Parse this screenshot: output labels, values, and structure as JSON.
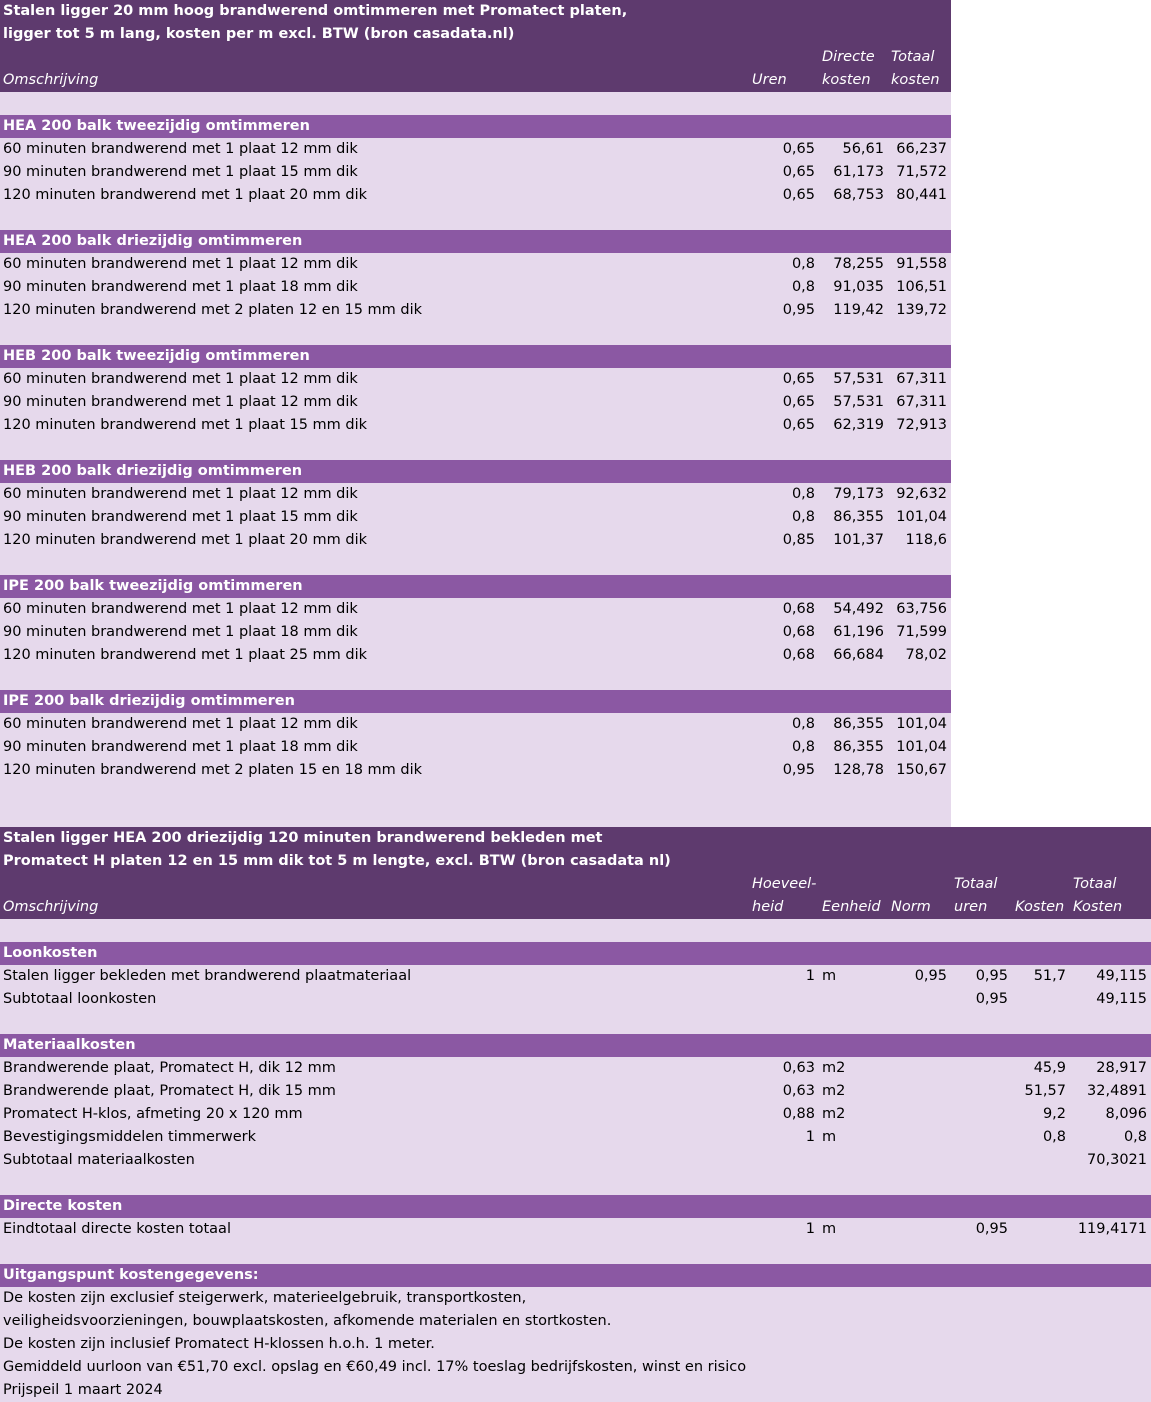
{
  "table1": {
    "title_line1": "Stalen ligger 20 mm hoog brandwerend omtimmeren met Promatect platen,",
    "title_line2": "ligger tot 5 m lang, kosten per m excl. BTW (bron casadata.nl)",
    "headers": {
      "omschrijving": "Omschrijving",
      "uren": "Uren",
      "directe_1": "Directe",
      "directe_2": "kosten",
      "totaal_1": "Totaal",
      "totaal_2": "kosten"
    },
    "sections": [
      {
        "title": "HEA 200 balk tweezijdig omtimmeren",
        "rows": [
          {
            "desc": "60 minuten brandwerend met 1 plaat 12 mm dik",
            "uren": "0,65",
            "direct": "56,61",
            "totaal": "66,237"
          },
          {
            "desc": "90 minuten brandwerend met 1 plaat 15 mm dik",
            "uren": "0,65",
            "direct": "61,173",
            "totaal": "71,572"
          },
          {
            "desc": "120 minuten brandwerend met 1 plaat 20 mm dik",
            "uren": "0,65",
            "direct": "68,753",
            "totaal": "80,441"
          }
        ]
      },
      {
        "title": "HEA 200 balk driezijdig omtimmeren",
        "rows": [
          {
            "desc": "60 minuten brandwerend met 1 plaat 12 mm dik",
            "uren": "0,8",
            "direct": "78,255",
            "totaal": "91,558"
          },
          {
            "desc": "90 minuten brandwerend met 1 plaat 18 mm dik",
            "uren": "0,8",
            "direct": "91,035",
            "totaal": "106,51"
          },
          {
            "desc": "120 minuten brandwerend met 2 platen 12 en 15 mm dik",
            "uren": "0,95",
            "direct": "119,42",
            "totaal": "139,72"
          }
        ]
      },
      {
        "title": "HEB 200 balk tweezijdig omtimmeren",
        "rows": [
          {
            "desc": "60 minuten brandwerend met 1 plaat 12 mm dik",
            "uren": "0,65",
            "direct": "57,531",
            "totaal": "67,311"
          },
          {
            "desc": "90 minuten brandwerend met 1 plaat 12 mm dik",
            "uren": "0,65",
            "direct": "57,531",
            "totaal": "67,311"
          },
          {
            "desc": "120 minuten brandwerend met 1 plaat 15 mm dik",
            "uren": "0,65",
            "direct": "62,319",
            "totaal": "72,913"
          }
        ]
      },
      {
        "title": "HEB 200 balk driezijdig omtimmeren",
        "rows": [
          {
            "desc": "60 minuten brandwerend met 1 plaat 12 mm dik",
            "uren": "0,8",
            "direct": "79,173",
            "totaal": "92,632"
          },
          {
            "desc": "90 minuten brandwerend met 1 plaat 15 mm dik",
            "uren": "0,8",
            "direct": "86,355",
            "totaal": "101,04"
          },
          {
            "desc": "120 minuten brandwerend met 1 plaat 20 mm dik",
            "uren": "0,85",
            "direct": "101,37",
            "totaal": "118,6"
          }
        ]
      },
      {
        "title": "IPE 200 balk tweezijdig omtimmeren",
        "rows": [
          {
            "desc": "60 minuten brandwerend met 1 plaat 12 mm dik",
            "uren": "0,68",
            "direct": "54,492",
            "totaal": "63,756"
          },
          {
            "desc": "90 minuten brandwerend met 1 plaat 18 mm dik",
            "uren": "0,68",
            "direct": "61,196",
            "totaal": "71,599"
          },
          {
            "desc": "120 minuten brandwerend met 1 plaat 25 mm dik",
            "uren": "0,68",
            "direct": "66,684",
            "totaal": "78,02"
          }
        ]
      },
      {
        "title": "IPE 200 balk driezijdig omtimmeren",
        "rows": [
          {
            "desc": "60 minuten brandwerend met 1 plaat 12 mm dik",
            "uren": "0,8",
            "direct": "86,355",
            "totaal": "101,04"
          },
          {
            "desc": "90 minuten brandwerend met 1 plaat 18 mm dik",
            "uren": "0,8",
            "direct": "86,355",
            "totaal": "101,04"
          },
          {
            "desc": "120 minuten brandwerend met 2 platen 15 en 18 mm dik",
            "uren": "0,95",
            "direct": "128,78",
            "totaal": "150,67"
          }
        ]
      }
    ]
  },
  "table2": {
    "title_line1": "Stalen ligger HEA 200 driezijdig 120 minuten brandwerend bekleden met",
    "title_line2": "Promatect H platen  12 en 15 mm dik tot 5 m lengte, excl. BTW (bron casadata nl)",
    "headers": {
      "omschrijving": "Omschrijving",
      "hoeveel_1": "Hoeveel-",
      "hoeveel_2": "heid",
      "eenheid": "Eenheid",
      "norm": "Norm",
      "totaal_uren_1": "Totaal",
      "totaal_uren_2": "uren",
      "kosten": "Kosten",
      "totaal_kosten_1": "Totaal",
      "totaal_kosten_2": "Kosten"
    },
    "loon": {
      "title": "Loonkosten",
      "rows": [
        {
          "desc": "Stalen ligger bekleden met brandwerend plaatmateriaal",
          "qty": "1",
          "unit": "m",
          "norm": "0,95",
          "uren": "0,95",
          "kosten": "51,7",
          "totaal": "49,115"
        },
        {
          "desc": "Subtotaal loonkosten",
          "qty": "",
          "unit": "",
          "norm": "",
          "uren": "0,95",
          "kosten": "",
          "totaal": "49,115"
        }
      ]
    },
    "materiaal": {
      "title": "Materiaalkosten",
      "rows": [
        {
          "desc": "Brandwerende plaat, Promatect H, dik 12 mm",
          "qty": "0,63",
          "unit": "m2",
          "norm": "",
          "uren": "",
          "kosten": "45,9",
          "totaal": "28,917"
        },
        {
          "desc": "Brandwerende plaat, Promatect H, dik 15 mm",
          "qty": "0,63",
          "unit": "m2",
          "norm": "",
          "uren": "",
          "kosten": "51,57",
          "totaal": "32,4891"
        },
        {
          "desc": "Promatect H-klos, afmeting 20 x 120 mm",
          "qty": "0,88",
          "unit": "m2",
          "norm": "",
          "uren": "",
          "kosten": "9,2",
          "totaal": "8,096"
        },
        {
          "desc": "Bevestigingsmiddelen timmerwerk",
          "qty": "1",
          "unit": "m",
          "norm": "",
          "uren": "",
          "kosten": "0,8",
          "totaal": "0,8"
        },
        {
          "desc": "Subtotaal materiaalkosten",
          "qty": "",
          "unit": "",
          "norm": "",
          "uren": "",
          "kosten": "",
          "totaal": "70,3021"
        }
      ]
    },
    "directe": {
      "title": "Directe kosten",
      "rows": [
        {
          "desc": "Eindtotaal directe kosten totaal",
          "qty": "1",
          "unit": "m",
          "norm": "",
          "uren": "0,95",
          "kosten": "",
          "totaal": "119,4171"
        }
      ]
    },
    "uitgangspunt": {
      "title": "Uitgangspunt kostengegevens:",
      "lines": [
        "De kosten zijn exclusief  steigerwerk, materieelgebruik, transportkosten,",
        "veiligheidsvoorzieningen, bouwplaatskosten, afkomende materialen en stortkosten.",
        "De kosten zijn inclusief Promatect H-klossen h.o.h. 1 meter.",
        "Gemiddeld uurloon van €51,70 excl. opslag en €60,49 incl. 17% toeslag bedrijfskosten, winst en risico",
        "Prijspeil 1 maart 2024"
      ]
    }
  }
}
